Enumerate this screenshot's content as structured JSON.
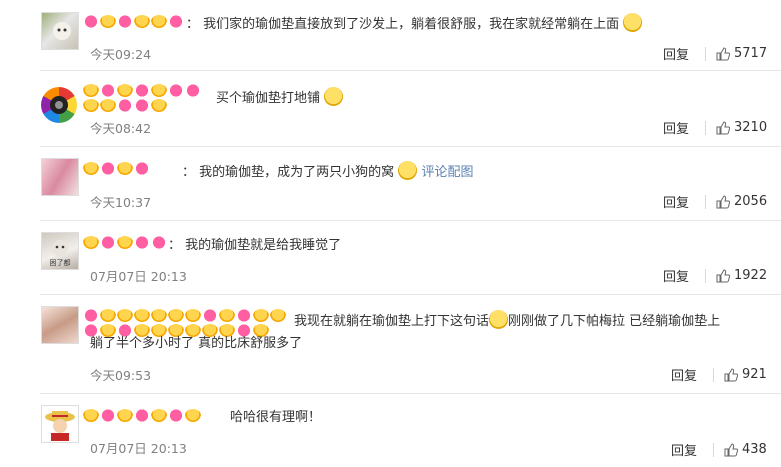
{
  "comments": [
    {
      "text": "我们家的瑜伽垫直接放到了沙发上，躺着很舒服，我在家就经常躺在上面",
      "time": "今天09:24",
      "reply": "回复",
      "likes": "5717"
    },
    {
      "text": "买个瑜伽垫打地铺",
      "time": "今天08:42",
      "reply": "回复",
      "likes": "3210"
    },
    {
      "text": "我的瑜伽垫，成为了两只小狗的窝",
      "link": "评论配图",
      "time": "今天10:37",
      "reply": "回复",
      "likes": "2056"
    },
    {
      "text": "我的瑜伽垫就是给我睡觉了",
      "time": "07月07日 20:13",
      "reply": "回复",
      "likes": "1922",
      "avatar_caption": "困了都"
    },
    {
      "text_line1a": "我现在就躺在瑜伽垫上打下这句话",
      "text_line1b": "刚刚做了几下帕梅拉 已经躺瑜伽垫上",
      "text_line2": "躺了半个多小时了 真的比床舒服多了",
      "time": "今天09:53",
      "reply": "回复",
      "likes": "921"
    },
    {
      "text": "哈哈很有理啊！",
      "time": "07月07日 20:13",
      "reply": "回复",
      "likes": "438"
    }
  ],
  "colors": {
    "link": "#5b80b2",
    "time": "#808080",
    "divider": "#e8e8e8"
  }
}
